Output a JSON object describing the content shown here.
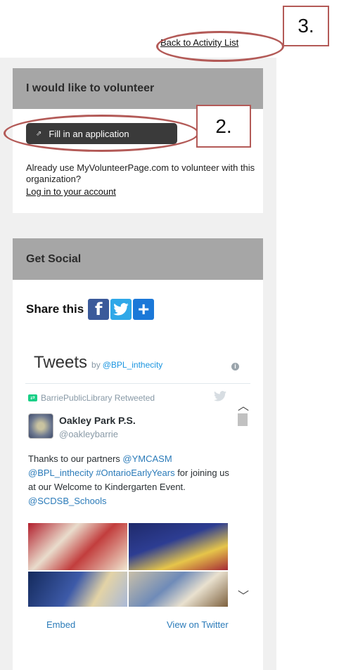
{
  "header": {
    "back_link": "Back to Activity List"
  },
  "volunteer_panel": {
    "title": "I would like to volunteer",
    "fill_button": "Fill in an application",
    "fill_icon": "external-link-icon",
    "already_text": "Already use MyVolunteerPage.com to volunteer with this organization?",
    "login_link": "Log in to your account"
  },
  "social_panel": {
    "title": "Get Social",
    "share_label": "Share this",
    "share_icons": [
      "facebook-icon",
      "twitter-icon",
      "plus-icon"
    ]
  },
  "twitter_widget": {
    "title": "Tweets",
    "by": "by",
    "handle": "@BPL_inthecity",
    "retweet_line": "BarriePublicLibrary Retweeted",
    "tweet": {
      "author_name": "Oakley Park P.S.",
      "author_handle": "@oakleybarrie",
      "text_1": "Thanks to our partners ",
      "mention_1": "@YMCASM",
      "mention_2": "@BPL_inthecity",
      "hashtag_1": "#OntarioEarlyYears",
      "text_2": " for joining us at our Welcome to Kindergarten Event. ",
      "mention_3": "@SCDSB_Schools"
    },
    "embed_link": "Embed",
    "view_link": "View on Twitter"
  },
  "annotations": {
    "label_3": "3.",
    "label_2": "2.",
    "color": "#b35a57"
  },
  "colors": {
    "panel_header_bg": "#a6a6a6",
    "button_bg": "#3a3a3a",
    "facebook": "#3b5a9a",
    "twitter": "#2fa8e8",
    "plus": "#1b78d8",
    "link_blue": "#2b7bb9"
  }
}
